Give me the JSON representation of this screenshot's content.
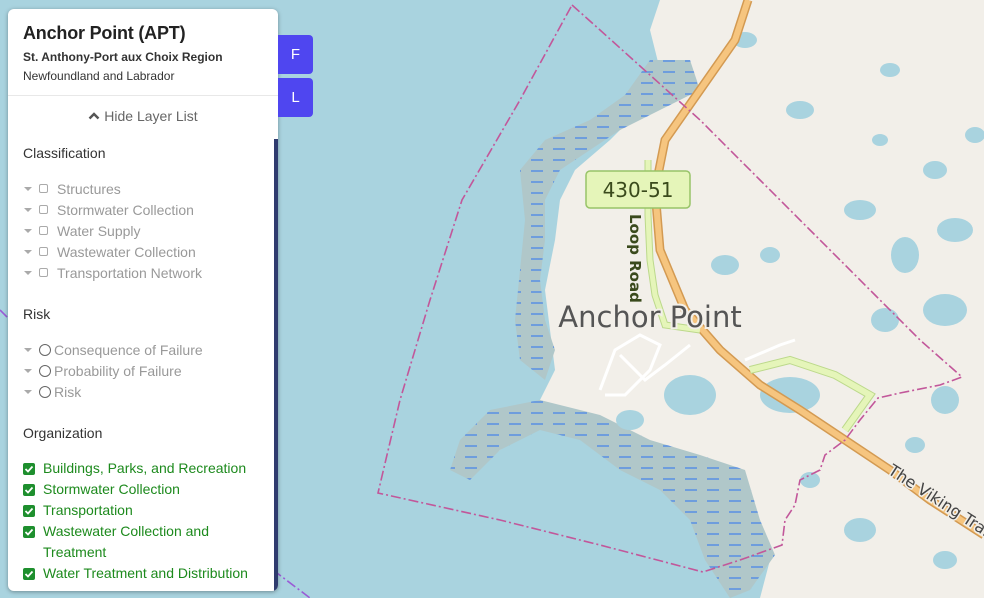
{
  "header": {
    "title": "Anchor Point (APT)",
    "region": "St. Anthony-Port aux Choix Region",
    "province": "Newfoundland and Labrador"
  },
  "toggle": {
    "label": "Hide Layer List"
  },
  "classification": {
    "title": "Classification",
    "items": [
      "Structures",
      "Stormwater Collection",
      "Water Supply",
      "Wastewater Collection",
      "Transportation Network"
    ]
  },
  "risk": {
    "title": "Risk",
    "items": [
      "Consequence of Failure",
      "Probability of Failure",
      "Risk"
    ]
  },
  "organization": {
    "title": "Organization",
    "items": [
      "Buildings, Parks, and Recreation",
      "Stormwater Collection",
      "Transportation",
      "Wastewater Collection and Treatment",
      "Water Treatment and Distribution"
    ]
  },
  "buttons": {
    "f": "F",
    "l": "L"
  },
  "map": {
    "place_label": "Anchor Point",
    "route_shield": "430-51",
    "road_label": "Loop Road",
    "highway_label": "The Viking Trail"
  },
  "colors": {
    "water": "#a9d3df",
    "land": "#f2efe9",
    "wetland": "#b0c7c9",
    "highway": "#f6c57f",
    "boundary": "#c2579a",
    "button": "#4f46f0",
    "checked": "#1e8f2e"
  }
}
